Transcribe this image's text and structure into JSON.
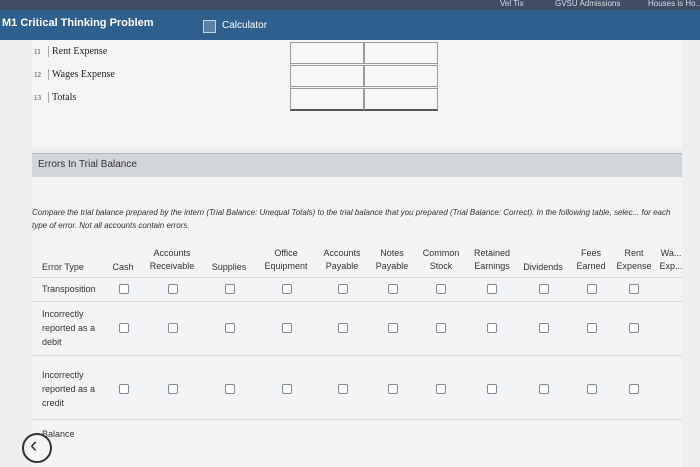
{
  "browser": {
    "links": [
      "Vel Tix",
      "GVSU Admissions",
      "Houses is Ho..."
    ]
  },
  "header": {
    "title": "M1 Critical Thinking Problem",
    "calculator_label": "Calculator"
  },
  "trial_balance": {
    "rows": [
      {
        "num": "11",
        "label": "Rent Expense"
      },
      {
        "num": "12",
        "label": "Wages Expense"
      },
      {
        "num": "13",
        "label": "Totals"
      }
    ]
  },
  "errors_section": {
    "title": "Errors In Trial Balance",
    "instructions": "Compare the trial balance prepared by the intern (Trial Balance: Unequal Totals) to the trial balance that you prepared (Trial Balance: Correct). In the following table, selec... for each type of error. Not all accounts contain errors.",
    "row_header": "Error Type",
    "columns": [
      "Cash",
      "Accounts Receivable",
      "Supplies",
      "Office Equipment",
      "Accounts Payable",
      "Notes Payable",
      "Common Stock",
      "Retained Earnings",
      "Dividends",
      "Fees Earned",
      "Rent Expense",
      "Wa... Exp..."
    ],
    "rows": [
      "Transposition",
      "Incorrectly reported as a debit",
      "Incorrectly reported as a credit",
      "Balance"
    ]
  },
  "colors": {
    "titlebar": "#2f5f8c",
    "panel": "#f3f4f5",
    "section_bar": "#d2d5da"
  }
}
